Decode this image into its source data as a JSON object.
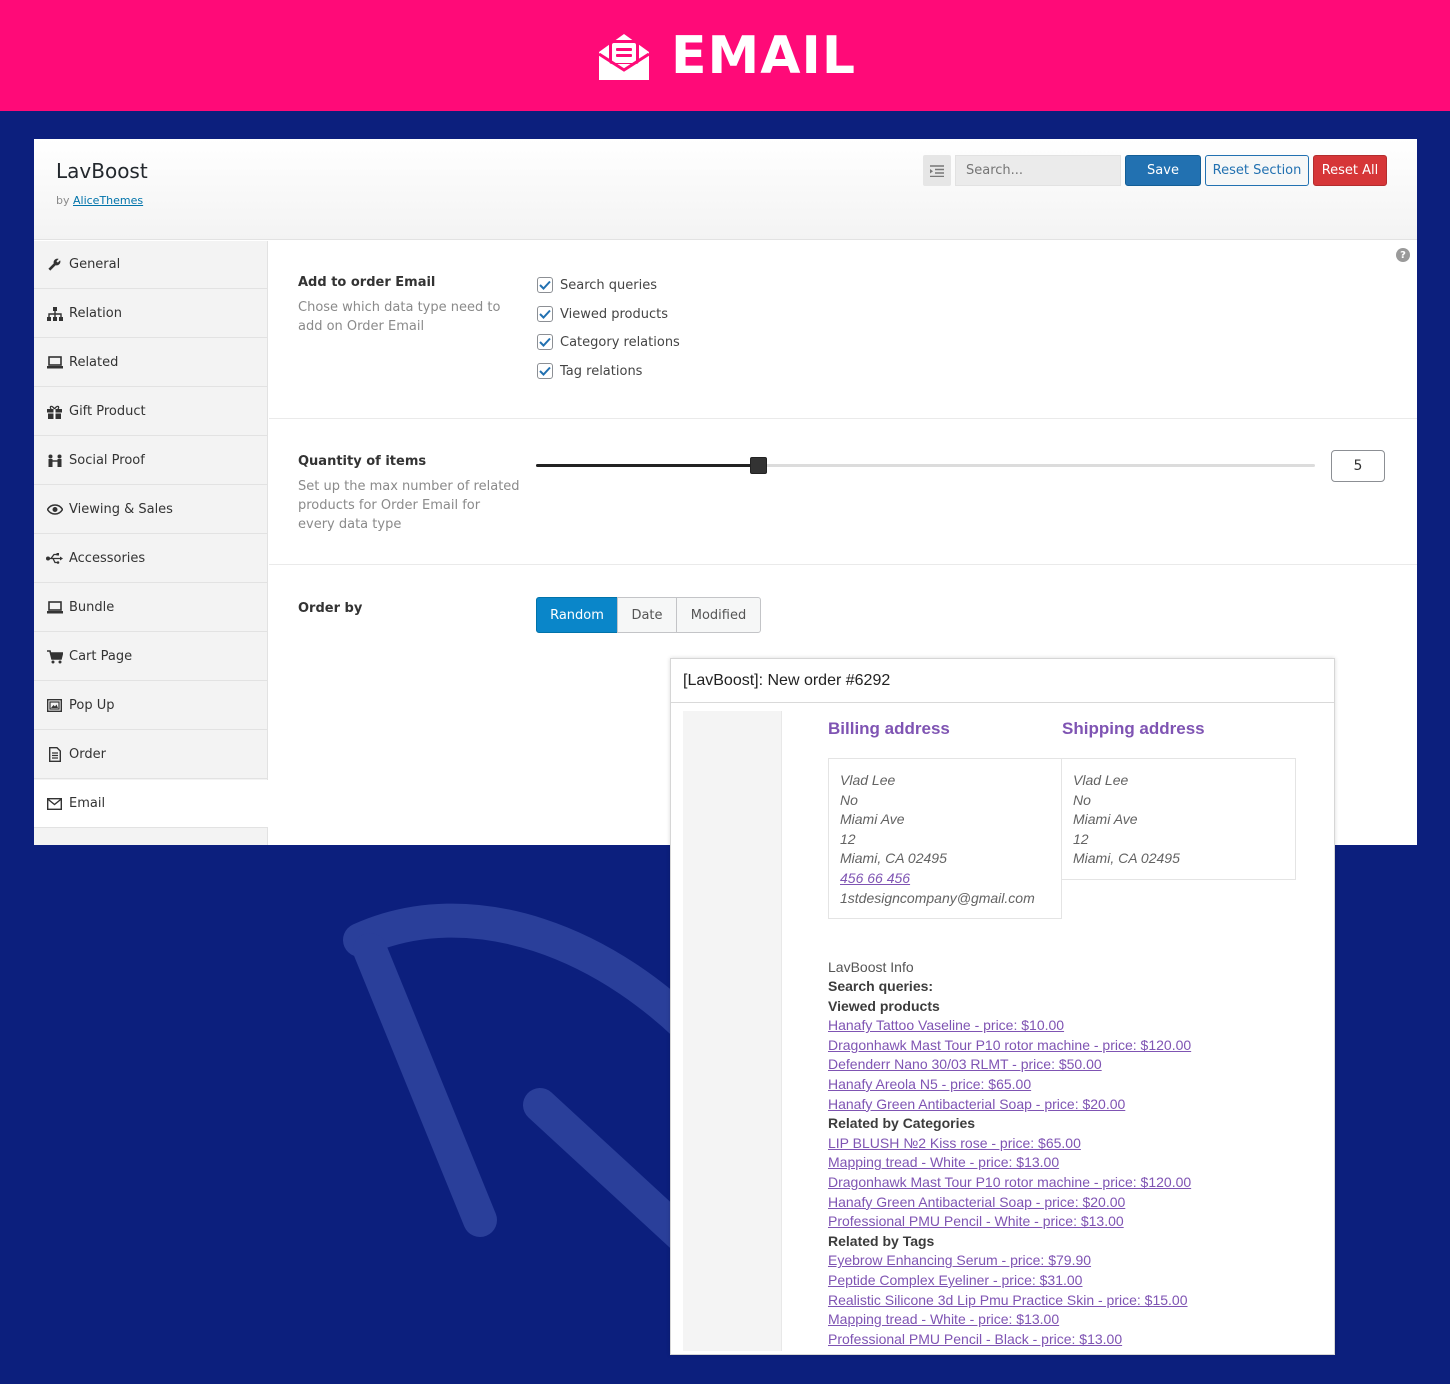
{
  "banner": {
    "title": "EMAIL",
    "icon": "envelope-open-icon"
  },
  "header": {
    "app_title": "LavBoost",
    "by_prefix": "by",
    "author": "AliceThemes",
    "search_placeholder": "Search...",
    "save": "Save",
    "reset_section": "Reset Section",
    "reset_all": "Reset All"
  },
  "sidebar": {
    "items": [
      {
        "label": "General",
        "icon": "wrench-icon"
      },
      {
        "label": "Relation",
        "icon": "sitemap-icon"
      },
      {
        "label": "Related",
        "icon": "laptop-icon"
      },
      {
        "label": "Gift Product",
        "icon": "gift-icon"
      },
      {
        "label": "Social Proof",
        "icon": "people-icon"
      },
      {
        "label": "Viewing & Sales",
        "icon": "eye-icon"
      },
      {
        "label": "Accessories",
        "icon": "usb-icon"
      },
      {
        "label": "Bundle",
        "icon": "laptop-icon"
      },
      {
        "label": "Cart Page",
        "icon": "cart-icon"
      },
      {
        "label": "Pop Up",
        "icon": "popup-icon"
      },
      {
        "label": "Order",
        "icon": "document-icon"
      },
      {
        "label": "Email",
        "icon": "envelope-icon"
      }
    ],
    "active": "Email"
  },
  "settings": {
    "add_to_email": {
      "title": "Add to order Email",
      "desc": "Chose which data type need to add on Order Email",
      "options": [
        {
          "label": "Search queries",
          "checked": true
        },
        {
          "label": "Viewed products",
          "checked": true
        },
        {
          "label": "Category relations",
          "checked": true
        },
        {
          "label": "Tag relations",
          "checked": true
        }
      ]
    },
    "quantity": {
      "title": "Quantity of items",
      "desc": "Set up the max number of related products for Order Email for every data type",
      "value": "5",
      "slider_fraction": 0.285
    },
    "order_by": {
      "title": "Order by",
      "options": [
        "Random",
        "Date",
        "Modified"
      ],
      "selected": "Random"
    }
  },
  "email": {
    "subject": "[LavBoost]: New order #6292",
    "billing": {
      "heading": "Billing address",
      "lines": [
        "Vlad Lee",
        "No",
        "Miami Ave",
        "12",
        "Miami, CA 02495"
      ],
      "phone": "456 66 456",
      "email": "1stdesigncompany@gmail.com"
    },
    "shipping": {
      "heading": "Shipping address",
      "lines": [
        "Vlad Lee",
        "No",
        "Miami Ave",
        "12",
        "Miami, CA 02495"
      ]
    },
    "info_title": "LavBoost Info",
    "search_queries_label": "Search queries:",
    "viewed_label": "Viewed products",
    "viewed": [
      "Hanafy Tattoo Vaseline - price: $10.00",
      "Dragonhawk Mast Tour P10 rotor machine - price: $120.00",
      "Defenderr Nano 30/03 RLMT - price: $50.00",
      "Hanafy Areola N5 - price: $65.00",
      "Hanafy Green Antibacterial Soap - price: $20.00"
    ],
    "categories_label": "Related by Categories",
    "categories": [
      "LIP BLUSH №2 Kiss rose - price: $65.00",
      "Mapping tread - White - price: $13.00",
      "Dragonhawk Mast Tour P10 rotor machine - price: $120.00",
      "Hanafy Green Antibacterial Soap - price: $20.00",
      "Professional PMU Pencil - White - price: $13.00"
    ],
    "tags_label": "Related by Tags",
    "tags": [
      "Eyebrow Enhancing Serum - price: $79.90",
      "Peptide Complex Eyeliner - price: $31.00",
      "Realistic Silicone 3d Lip Pmu Practice Skin - price: $15.00",
      "Mapping tread - White - price: $13.00",
      "Professional PMU Pencil - Black - price: $13.00"
    ]
  },
  "colors": {
    "banner": "#ff0a78",
    "background": "#0c1f7d",
    "accent": "#2271b1",
    "danger": "#d63638",
    "email_link": "#7f54b3"
  }
}
